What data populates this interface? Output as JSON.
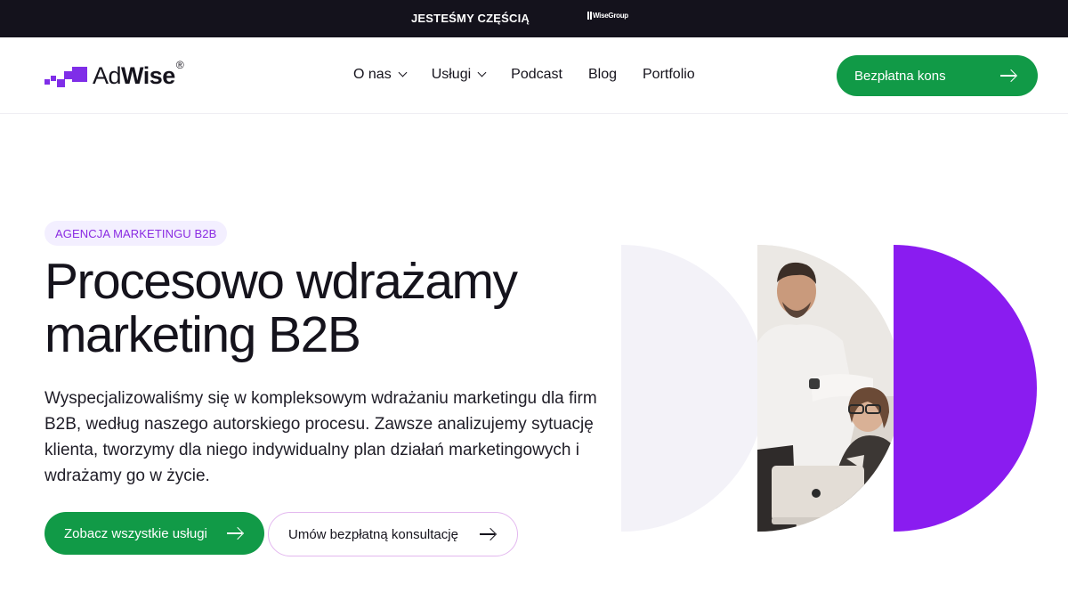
{
  "topbar": {
    "text": "JESTEŚMY CZĘŚCIĄ",
    "logo_text": "WiseGroup"
  },
  "header": {
    "logo": {
      "text_light": "Ad",
      "text_bold": "Wise",
      "reg": "®"
    },
    "nav": [
      {
        "label": "O nas",
        "has_dropdown": true
      },
      {
        "label": "Usługi",
        "has_dropdown": true
      },
      {
        "label": "Podcast",
        "has_dropdown": false
      },
      {
        "label": "Blog",
        "has_dropdown": false
      },
      {
        "label": "Portfolio",
        "has_dropdown": false
      }
    ],
    "cta_label": "Bezpłatna kons"
  },
  "hero": {
    "badge": "AGENCJA MARKETINGU B2B",
    "title_line1": "Procesowo wdrażamy",
    "title_line2": "marketing B2B",
    "description": "Wyspecjalizowaliśmy się w kompleksowym wdrażaniu marketingu dla firm B2B, według naszego autorskiego procesu. Zawsze analizujemy sytuację klienta, tworzymy dla niego indywidualny plan działań marketingowych i wdrażamy go w życie.",
    "primary_button": "Zobacz wszystkie usługi",
    "secondary_button": "Umów bezpłatną konsultację"
  },
  "colors": {
    "brand_purple": "#8a1cf0",
    "brand_green": "#119a47",
    "dark": "#14121c",
    "badge_bg": "#f3efff"
  }
}
